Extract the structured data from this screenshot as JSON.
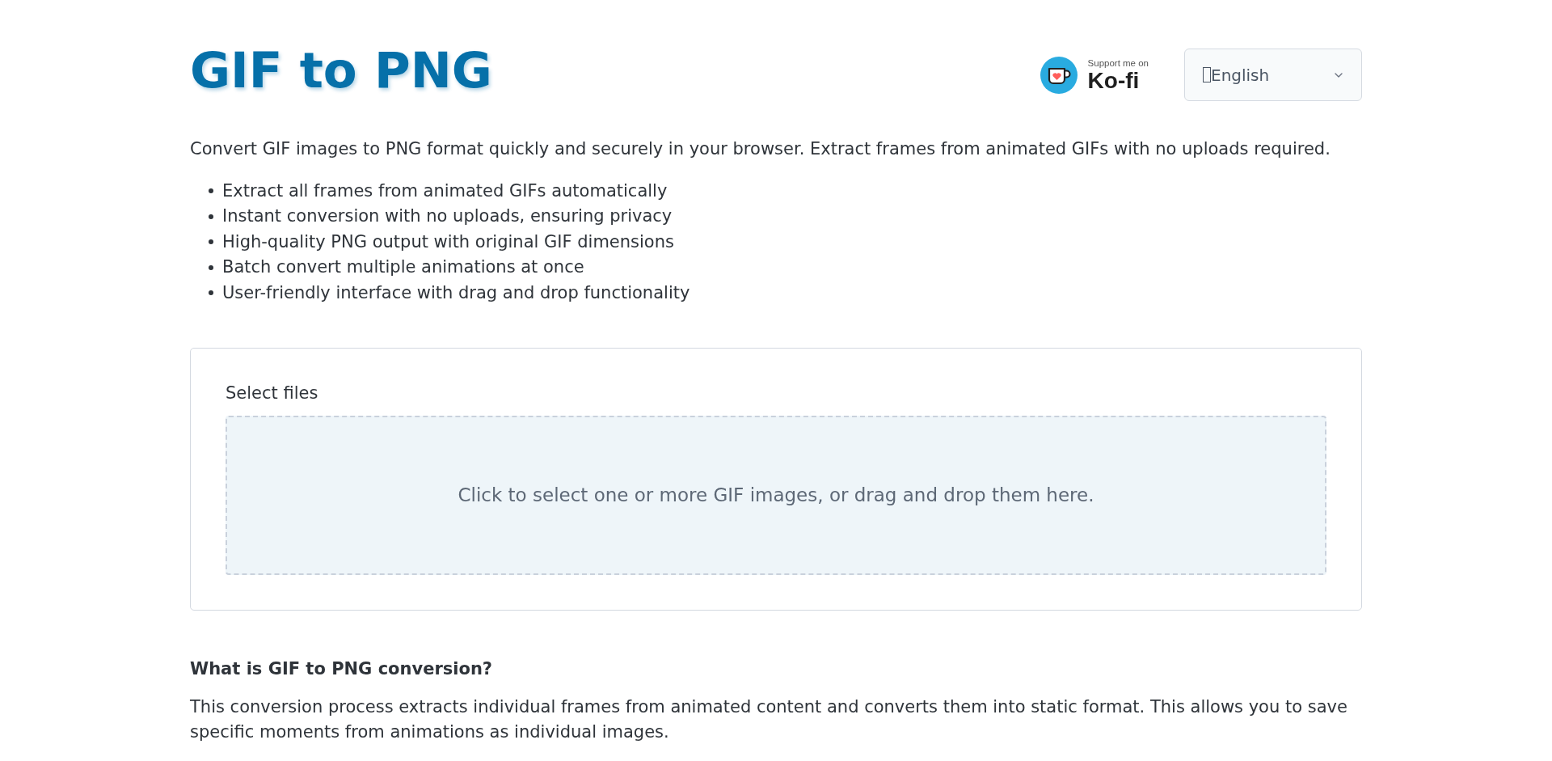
{
  "header": {
    "title": "GIF to PNG",
    "support_link": {
      "caption": "Support me on",
      "brand": "Ko-fi"
    },
    "language_select": {
      "value": "English"
    }
  },
  "intro": {
    "text": "Convert GIF images to PNG format quickly and securely in your browser. Extract frames from animated GIFs with no uploads required.",
    "features": [
      "Extract all frames from animated GIFs automatically",
      "Instant conversion with no uploads, ensuring privacy",
      "High-quality PNG output with original GIF dimensions",
      "Batch convert multiple animations at once",
      "User-friendly interface with drag and drop functionality"
    ]
  },
  "upload": {
    "label": "Select files",
    "dropzone": {
      "text": "Click to select one or more GIF images, or drag and drop them here."
    }
  },
  "faq": {
    "heading": "What is GIF to PNG conversion?",
    "text": "This conversion process extracts individual frames from animated content and converts them into static format. This allows you to save specific moments from animations as individual images."
  }
}
